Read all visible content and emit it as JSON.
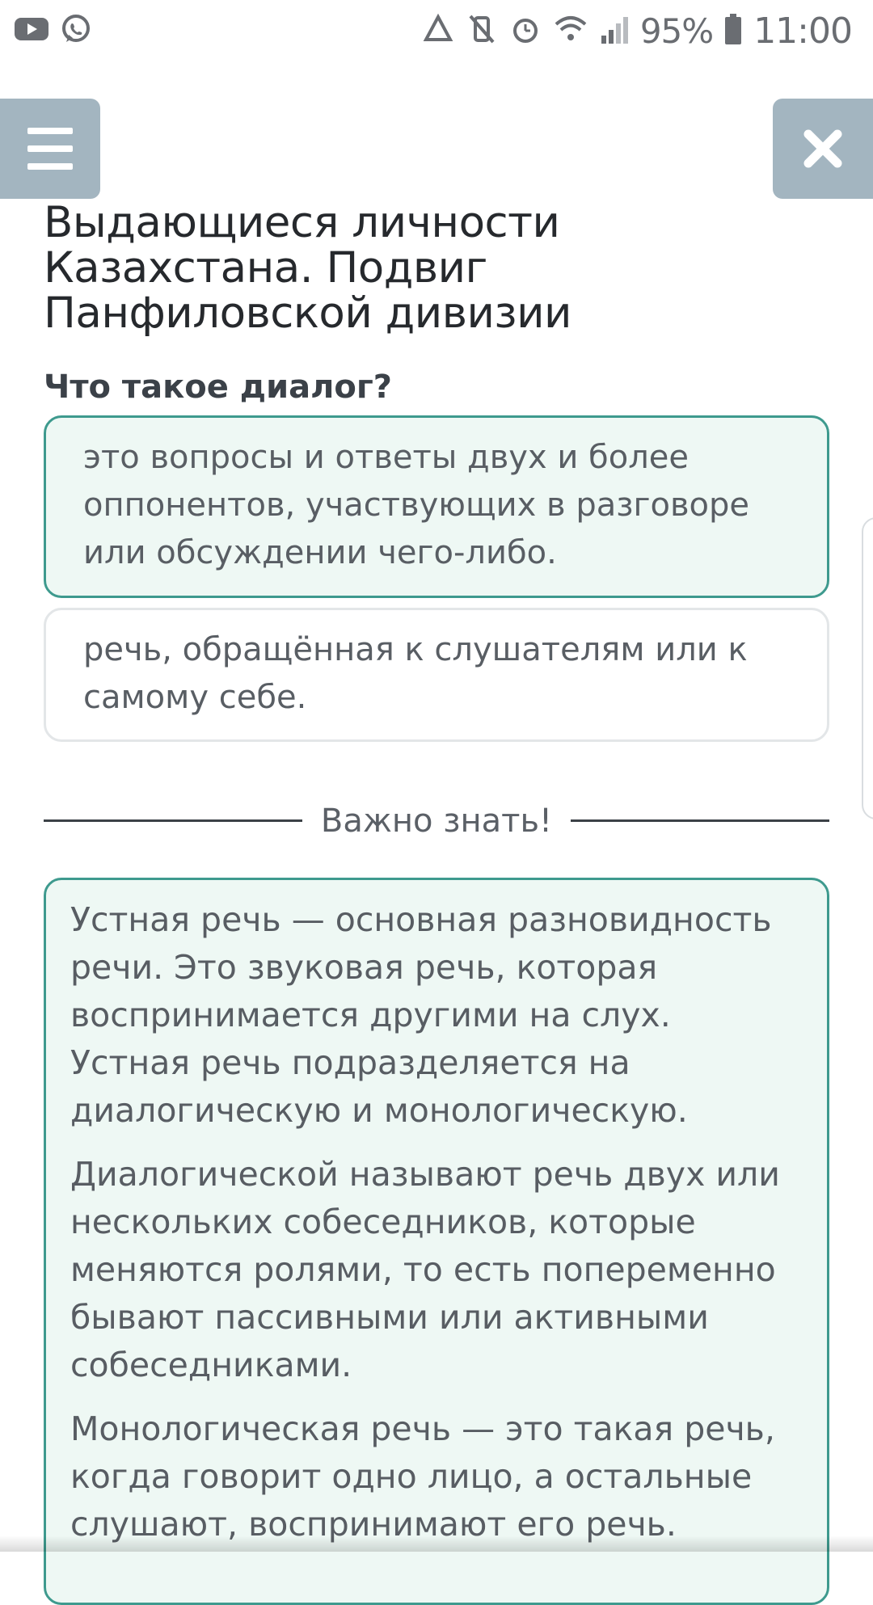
{
  "status_bar": {
    "left_icons": [
      "youtube-icon",
      "whatsapp-icon"
    ],
    "right_icons": [
      "recycle-icon",
      "vibrate-off-icon",
      "alarm-icon",
      "wifi-icon",
      "signal-icon",
      "battery-icon"
    ],
    "battery_percent": "95%",
    "time": "11:00"
  },
  "header": {
    "title": "Выдающиеся личности Казахстана. Подвиг Панфиловской дивизии"
  },
  "quiz": {
    "question": "Что такое диалог?",
    "options": [
      {
        "text": "это вопросы и ответы двух и более оппонентов, участвующих в разговоре или обсуждении чего-либо.",
        "selected": true
      },
      {
        "text": "речь, обращённая к слушателям или к самому себе.",
        "selected": false
      }
    ]
  },
  "important": {
    "label": "Важно знать!",
    "paragraphs": [
      "Устная речь — основная разновидность речи. Это звуковая речь, которая воспринимается другими на слух. Устная речь подразделяется на диалогическую и монологическую.",
      "Диалогической называют речь двух или нескольких собеседников, которые меняются ролями, то есть попеременно бывают пассивными или активными собеседниками.",
      "Монологическая речь — это такая речь, когда говорит одно лицо, а остальные слушают, воспринимают его речь."
    ]
  },
  "colors": {
    "accent_green": "#3e9a8e",
    "selected_bg": "#eef8f4",
    "nav_button_bg": "#a3b5c0"
  }
}
